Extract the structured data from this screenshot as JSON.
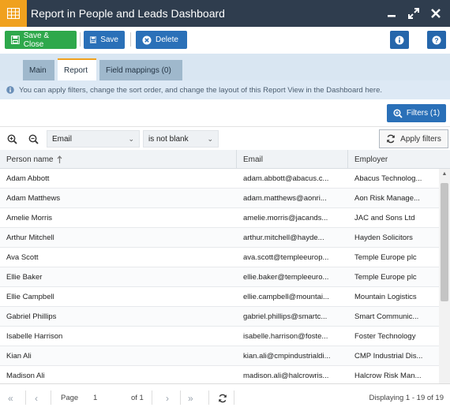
{
  "window": {
    "title": "Report in People and Leads Dashboard",
    "app_icon": "table-grid-icon",
    "accent": "#f0a11e",
    "titlebar_color": "#2f3d4e"
  },
  "toolbar": {
    "save_close_label": "Save & Close",
    "save_label": "Save",
    "delete_label": "Delete"
  },
  "tabs": [
    {
      "label": "Main"
    },
    {
      "label": "Report"
    },
    {
      "label": "Field mappings (0)"
    }
  ],
  "active_tab": "Report",
  "info_text": "You can apply filters, change the sort order, and change the layout of this Report View in the Dashboard here.",
  "filters_button": "Filters (1)",
  "filter": {
    "field": "Email",
    "operator": "is not blank",
    "apply_label": "Apply filters"
  },
  "grid": {
    "columns": [
      "Person name",
      "Email",
      "Employer"
    ],
    "sorted_column": "Person name",
    "rows": [
      [
        "Adam Abbott",
        "adam.abbott@abacus.c...",
        "Abacus Technolog..."
      ],
      [
        "Adam Matthews",
        "adam.matthews@aonri...",
        "Aon Risk Manage..."
      ],
      [
        "Amelie Morris",
        "amelie.morris@jacands...",
        "JAC and Sons Ltd"
      ],
      [
        "Arthur Mitchell",
        "arthur.mitchell@hayde...",
        "Hayden Solicitors"
      ],
      [
        "Ava Scott",
        "ava.scott@templeeurop...",
        "Temple Europe plc"
      ],
      [
        "Ellie Baker",
        "ellie.baker@templeeuro...",
        "Temple Europe plc"
      ],
      [
        "Ellie Campbell",
        "ellie.campbell@mountai...",
        "Mountain Logistics"
      ],
      [
        "Gabriel Phillips",
        "gabriel.phillips@smartc...",
        "Smart Communic..."
      ],
      [
        "Isabelle Harrison",
        "isabelle.harrison@foste...",
        "Foster Technology"
      ],
      [
        "Kian Ali",
        "kian.ali@cmpindustrialdi...",
        "CMP Industrial Dis..."
      ],
      [
        "Madison Ali",
        "madison.ali@halcrowris...",
        "Halcrow Risk Man..."
      ]
    ]
  },
  "pager": {
    "page_label": "Page",
    "page_value": "1",
    "of_label": "of 1",
    "displaying": "Displaying 1 - 19 of 19"
  }
}
